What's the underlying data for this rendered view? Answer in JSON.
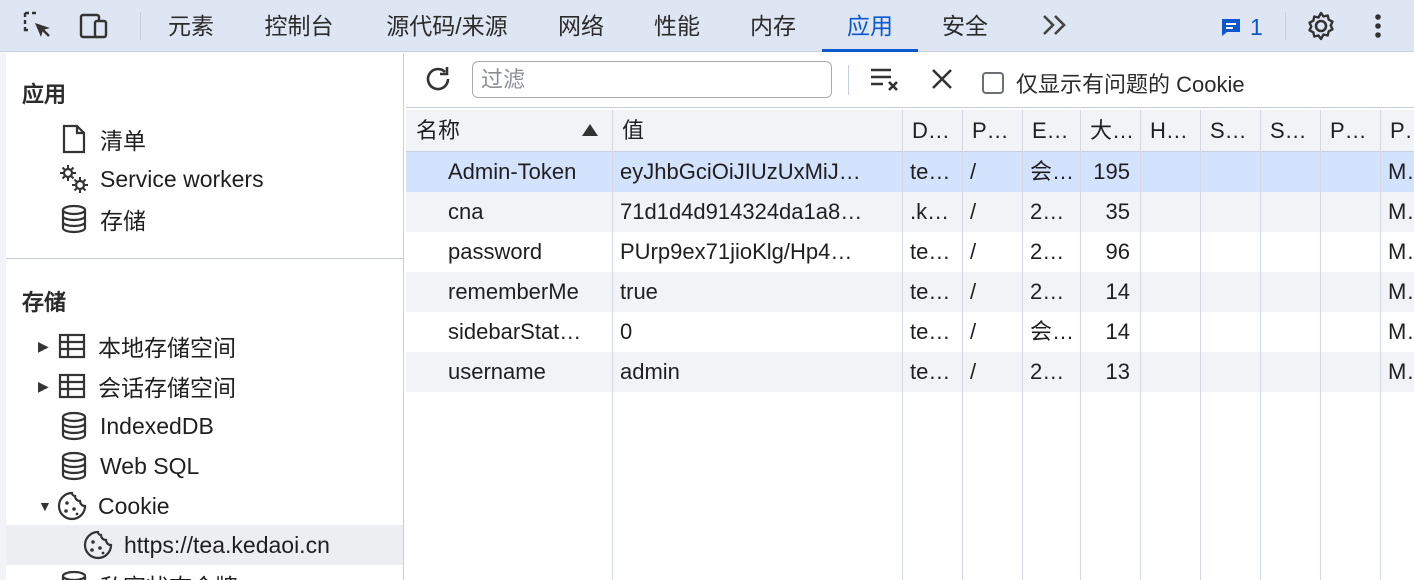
{
  "tabs": [
    {
      "label": "元素",
      "active": false
    },
    {
      "label": "控制台",
      "active": false
    },
    {
      "label": "源代码/来源",
      "active": false
    },
    {
      "label": "网络",
      "active": false
    },
    {
      "label": "性能",
      "active": false
    },
    {
      "label": "内存",
      "active": false
    },
    {
      "label": "应用",
      "active": true
    },
    {
      "label": "安全",
      "active": false
    }
  ],
  "more_tabs": "»",
  "issues_count": "1",
  "accent": "#0b57d0",
  "sidebar": {
    "app_section_title": "应用",
    "app_items": [
      {
        "label": "清单",
        "icon": "file-icon"
      },
      {
        "label": "Service workers",
        "icon": "gears-icon"
      },
      {
        "label": "存储",
        "icon": "database-icon"
      }
    ],
    "storage_section_title": "存储",
    "storage_items": [
      {
        "label": "本地存储空间",
        "icon": "table-icon",
        "arrow": "▶"
      },
      {
        "label": "会话存储空间",
        "icon": "table-icon",
        "arrow": "▶"
      },
      {
        "label": "IndexedDB",
        "icon": "database-icon"
      },
      {
        "label": "Web SQL",
        "icon": "database-icon"
      },
      {
        "label": "Cookie",
        "icon": "cookie-icon",
        "arrow": "▼"
      },
      {
        "label": "https://tea.kedaoi.cn",
        "icon": "cookie-icon"
      },
      {
        "label": "私密状态令牌",
        "icon": "database-icon"
      }
    ]
  },
  "toolbar": {
    "filter_placeholder": "过滤",
    "only_issues_label": "仅显示有问题的 Cookie"
  },
  "table": {
    "columns": [
      "名称",
      "值",
      "D…",
      "P…",
      "E…",
      "大…",
      "H…",
      "S…",
      "S…",
      "P…",
      "P…"
    ],
    "rows": [
      [
        "Admin-Token",
        "eyJhbGciOiJIUzUxMiJ…",
        "te…",
        "/",
        "会…",
        "195",
        "",
        "",
        "",
        "",
        "M…"
      ],
      [
        "cna",
        "71d1d4d914324da1a8…",
        ".k…",
        "/",
        "2…",
        "35",
        "",
        "",
        "",
        "",
        "M…"
      ],
      [
        "password",
        "PUrp9ex71jioKlg/Hp4…",
        "te…",
        "/",
        "2…",
        "96",
        "",
        "",
        "",
        "",
        "M…"
      ],
      [
        "rememberMe",
        "true",
        "te…",
        "/",
        "2…",
        "14",
        "",
        "",
        "",
        "",
        "M…"
      ],
      [
        "sidebarStat…",
        "0",
        "te…",
        "/",
        "会…",
        "14",
        "",
        "",
        "",
        "",
        "M…"
      ],
      [
        "username",
        "admin",
        "te…",
        "/",
        "2…",
        "13",
        "",
        "",
        "",
        "",
        "M…"
      ]
    ]
  }
}
